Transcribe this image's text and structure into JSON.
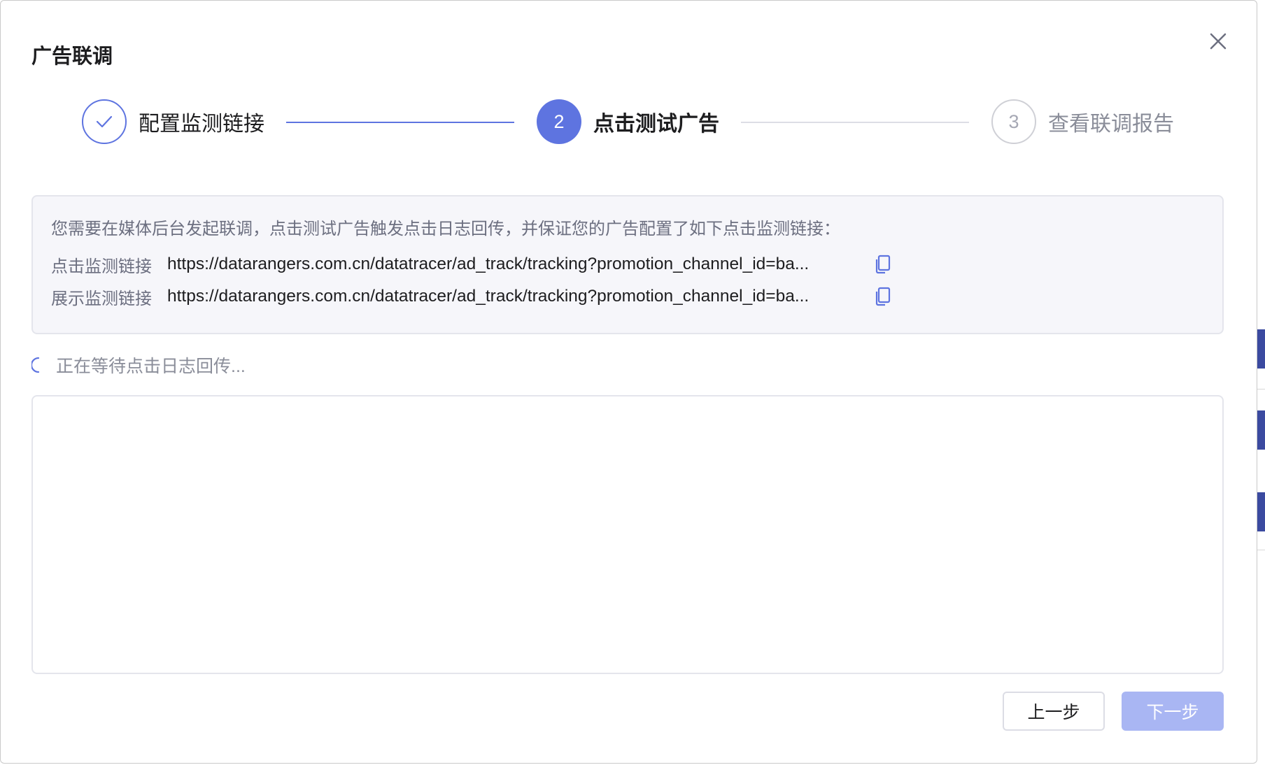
{
  "dialog": {
    "title": "广告联调",
    "close_icon": "close-icon"
  },
  "steps": [
    {
      "number": "",
      "label": "配置监测链接",
      "state": "completed"
    },
    {
      "number": "2",
      "label": "点击测试广告",
      "state": "active"
    },
    {
      "number": "3",
      "label": "查看联调报告",
      "state": "pending"
    }
  ],
  "info": {
    "description": "您需要在媒体后台发起联调，点击测试广告触发点击日志回传，并保证您的广告配置了如下点击监测链接：",
    "click_link_label": "点击监测链接",
    "click_link_url": "https://datarangers.com.cn/datatracer/ad_track/tracking?promotion_channel_id=ba...",
    "impression_link_label": "展示监测链接",
    "impression_link_url": "https://datarangers.com.cn/datatracer/ad_track/tracking?promotion_channel_id=ba..."
  },
  "status": {
    "waiting_text": "正在等待点击日志回传..."
  },
  "buttons": {
    "prev_label": "上一步",
    "next_label": "下一步"
  },
  "colors": {
    "primary": "#5e74e0",
    "primary_disabled": "#a9b6f3",
    "info_bg": "#f6f6fa"
  }
}
